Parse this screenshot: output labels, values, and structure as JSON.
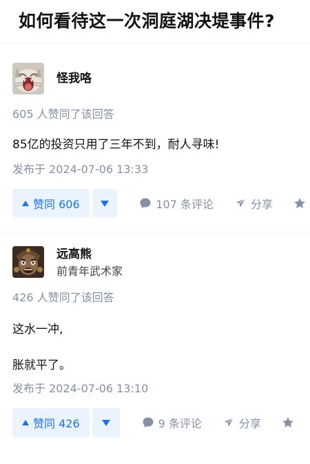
{
  "question": {
    "title": "如何看待这一次洞庭湖决堤事件?"
  },
  "answers": [
    {
      "author": {
        "name": "怪我咯",
        "avatar_icon": "cat-avatar"
      },
      "vote_summary": "605 人赞同了该回答",
      "paragraphs": [
        "85亿的投资只用了三年不到，耐人寻味!"
      ],
      "published": "发布于 2024-07-06 13:33",
      "actions": {
        "vote_up_label": "赞同 606",
        "comments_label": "107 条评论",
        "share_label": "分享"
      }
    },
    {
      "author": {
        "name": "远高熊",
        "bio": "前青年武术家",
        "avatar_icon": "warrior-statue-avatar"
      },
      "vote_summary": "426 人赞同了该回答",
      "paragraphs": [
        "这水一冲,",
        "胀就平了。"
      ],
      "published": "发布于 2024-07-06 13:10",
      "actions": {
        "vote_up_label": "赞同 426",
        "comments_label": "9 条评论",
        "share_label": "分享"
      }
    }
  ],
  "colors": {
    "accent": "#1772f6",
    "accent_bg": "#ebf3fe",
    "muted": "#8590a6"
  }
}
